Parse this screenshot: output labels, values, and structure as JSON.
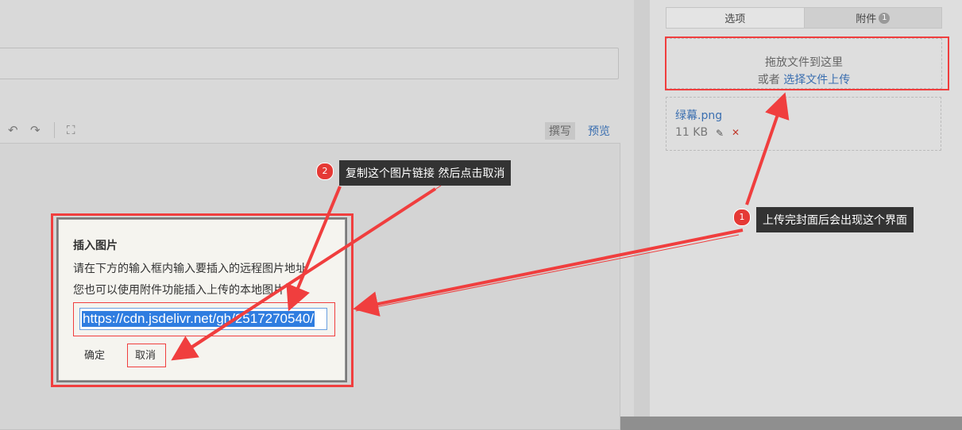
{
  "editor": {
    "tool_icons": [
      "undo-icon",
      "redo-icon",
      "fullscreen-icon"
    ],
    "mode_write": "撰写",
    "mode_preview": "预览"
  },
  "sidebar": {
    "tab_options": "选项",
    "tab_attachments": "附件",
    "attachments_count": "1",
    "drop_text": "拖放文件到这里",
    "or_text": "或者",
    "choose_link": "选择文件上传",
    "file": {
      "name": "绿幕.png",
      "size": "11 KB"
    }
  },
  "dialog": {
    "title": "插入图片",
    "line1": "请在下方的输入框内输入要插入的远程图片地址",
    "line2": "您也可以使用附件功能插入上传的本地图片",
    "url_value": "https://cdn.jsdelivr.net/gh/2517270540/",
    "ok_label": "确定",
    "cancel_label": "取消"
  },
  "annotations": {
    "step1_num": "1",
    "step1_text": "上传完封面后会出现这个界面",
    "step2_num": "2",
    "step2_text": "复制这个图片链接  然后点击取消",
    "highlight_color": "#f03e3e"
  }
}
